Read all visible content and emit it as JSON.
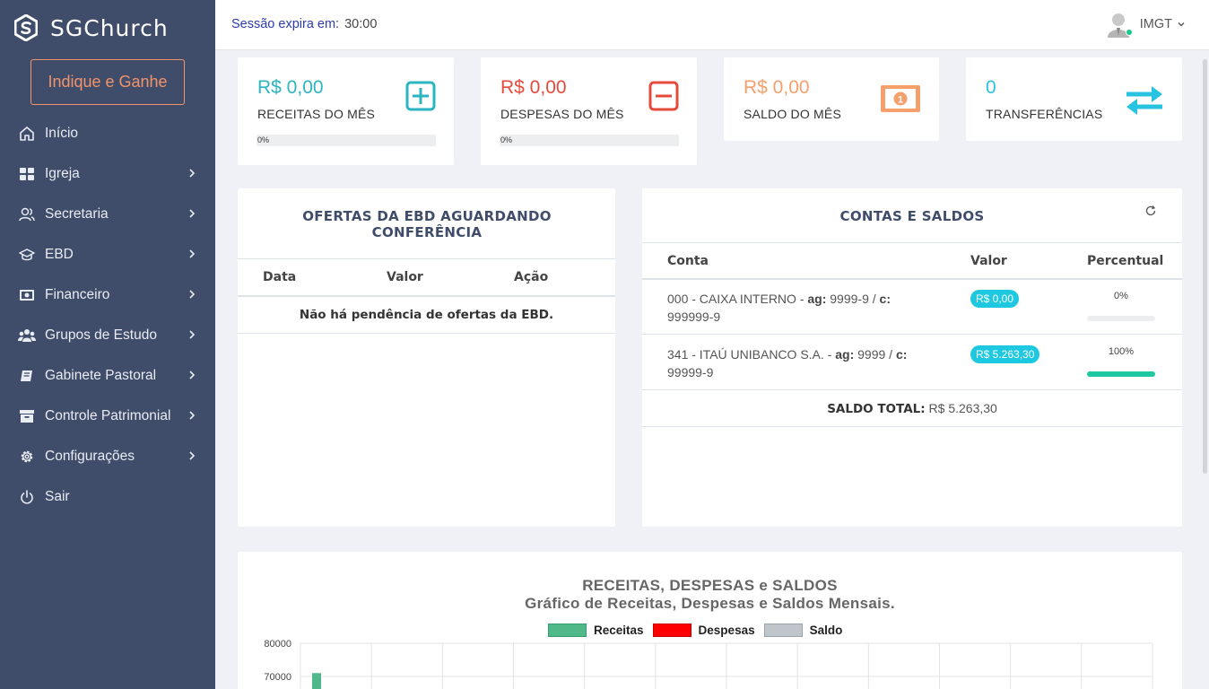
{
  "brand": {
    "name": "SGChurch"
  },
  "promo": {
    "label": "Indique e Ganhe"
  },
  "menu": [
    {
      "label": "Início",
      "icon": "home-icon",
      "submenu": false
    },
    {
      "label": "Igreja",
      "icon": "grid-icon",
      "submenu": true
    },
    {
      "label": "Secretaria",
      "icon": "users-icon",
      "submenu": true
    },
    {
      "label": "EBD",
      "icon": "graduation-cap-icon",
      "submenu": true
    },
    {
      "label": "Financeiro",
      "icon": "money-icon",
      "submenu": true
    },
    {
      "label": "Grupos de Estudo",
      "icon": "group-icon",
      "submenu": true
    },
    {
      "label": "Gabinete Pastoral",
      "icon": "book-icon",
      "submenu": true
    },
    {
      "label": "Controle Patrimonial",
      "icon": "archive-icon",
      "submenu": true
    },
    {
      "label": "Configurações",
      "icon": "gear-icon",
      "submenu": true
    },
    {
      "label": "Sair",
      "icon": "power-icon",
      "submenu": false
    }
  ],
  "topbar": {
    "session_label": "Sessão expira em:",
    "session_time": "30:00",
    "user_name": "IMGT"
  },
  "stats": {
    "receitas": {
      "value": "R$ 0,00",
      "label": "RECEITAS DO MÊS",
      "progress_text": "0%",
      "progress": 0,
      "color": "#2bb5c0"
    },
    "despesas": {
      "value": "R$ 0,00",
      "label": "DESPESAS DO MÊS",
      "progress_text": "0%",
      "progress": 0,
      "color": "#e64a3b"
    },
    "saldo": {
      "value": "R$ 0,00",
      "label": "SALDO DO MÊS",
      "color": "#f5a06c"
    },
    "transferencias": {
      "value": "0",
      "label": "TRANSFERÊNCIAS",
      "color": "#27c3e0"
    }
  },
  "ebd": {
    "title": "OFERTAS DA EBD AGUARDANDO CONFERÊNCIA",
    "columns": [
      "Data",
      "Valor",
      "Ação"
    ],
    "empty": "Não há pendência de ofertas da EBD."
  },
  "contas": {
    "title": "CONTAS E SALDOS",
    "columns": [
      "Conta",
      "Valor",
      "Percentual"
    ],
    "rows": [
      {
        "name": "000 - CAIXA INTERNO - ",
        "ag_label": "ag:",
        "ag": " 9999-9 / ",
        "c_label": "c:",
        "c": " 999999-9",
        "value": "R$ 0,00",
        "pct_text": "0%",
        "pct": 0
      },
      {
        "name": "341 - ITAÚ UNIBANCO S.A. - ",
        "ag_label": "ag:",
        "ag": " 9999 / ",
        "c_label": "c:",
        "c": " 99999-9",
        "value": "R$ 5.263,30",
        "pct_text": "100%",
        "pct": 100
      }
    ],
    "total_label": "SALDO TOTAL:",
    "total_value": " R$ 5.263,30"
  },
  "chart_data": {
    "type": "bar",
    "title": "RECEITAS, DESPESAS e SALDOS",
    "subtitle": "Gráfico de Receitas, Despesas e Saldos Mensais.",
    "legend_position": "top",
    "series": [
      {
        "name": "Receitas",
        "color": "#4fb98a",
        "values": [
          71000
        ]
      },
      {
        "name": "Despesas",
        "color": "#ff0000",
        "values": []
      },
      {
        "name": "Saldo",
        "color": "#b7bcc4",
        "values": []
      }
    ],
    "y_ticks": [
      "80000",
      "70000"
    ],
    "ylim": [
      0,
      80000
    ],
    "grid": true
  }
}
